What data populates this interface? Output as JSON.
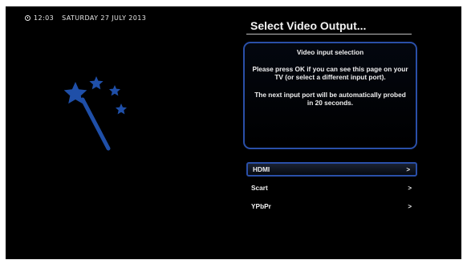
{
  "status_bar": {
    "time": "12:03",
    "date": "SATURDAY 27 JULY 2013"
  },
  "wizard": {
    "title": "Select Video Output..."
  },
  "info_box": {
    "heading": "Video input selection",
    "text": "Please press OK if you can see this page on your TV (or select a different input port).",
    "text2": "The next input port will be automatically probed in 20 seconds."
  },
  "menu": {
    "items": [
      {
        "label": "HDMI",
        "arrow": ">",
        "selected": true
      },
      {
        "label": "Scart",
        "arrow": ">",
        "selected": false
      },
      {
        "label": "YPbPr",
        "arrow": ">",
        "selected": false
      }
    ]
  },
  "colors": {
    "accent": "#2a4fa8",
    "wand_star": "#1f4fa8",
    "background": "#000000",
    "text": "#f0f0f0"
  },
  "icons": {
    "clock": "clock-icon",
    "wizard": "magic-wand-icon"
  }
}
